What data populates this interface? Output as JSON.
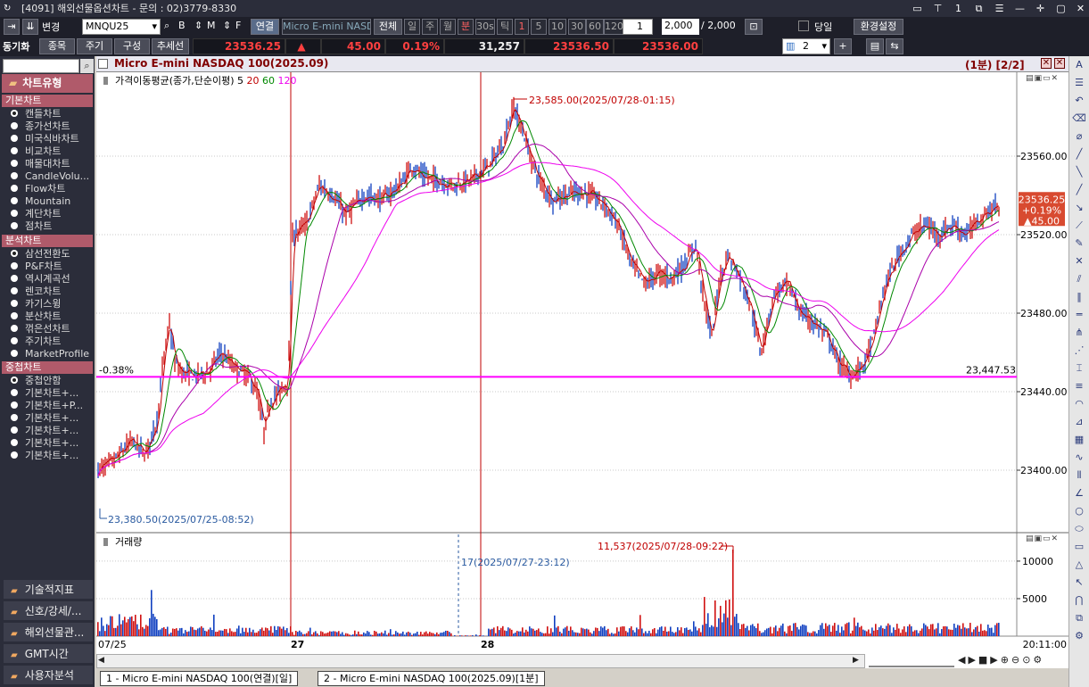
{
  "window": {
    "title": "[4091] 해외선물옵션차트 - 문의 : 02)3779-8330"
  },
  "toolbar": {
    "change_label": "변경",
    "symbol": "MNQU25",
    "b": "B",
    "m": "M",
    "f": "F",
    "link": "연결",
    "all": "전체",
    "periods": [
      "일",
      "주",
      "월",
      "분",
      "30s",
      "틱"
    ],
    "active_period": "분",
    "intervals": [
      "1",
      "5",
      "10",
      "30",
      "60",
      "120"
    ],
    "active_interval": "1",
    "count_value": "1",
    "data_count": "2,000",
    "data_total": "/ 2,000",
    "today": "당일",
    "settings": "환경설정",
    "sync": "동기화",
    "item": "종목",
    "cycle": "주기",
    "compose": "구성",
    "trendline": "추세선",
    "page_num": "2"
  },
  "quote": {
    "price": "23536.25",
    "arrow": "▲",
    "change": "45.00",
    "pct": "0.19%",
    "volume": "31,257",
    "ask": "23536.50",
    "bid": "23536.00"
  },
  "left": {
    "chart_type_head": "차트유형",
    "sections": [
      {
        "head": "기본차트",
        "items": [
          "캔들차트",
          "종가선차트",
          "미국식바차트",
          "비교차트",
          "매물대차트",
          "CandleVolu...",
          "Flow차트",
          "Mountain",
          "계단차트",
          "점차트"
        ]
      },
      {
        "head": "분석차트",
        "items": [
          "삼선전환도",
          "P&F차트",
          "역시계곡선",
          "렌코차트",
          "카기스윙",
          "분산차트",
          "꺾은선차트",
          "주기차트",
          "MarketProfile"
        ]
      },
      {
        "head": "중첩차트",
        "items": [
          "중첩안함",
          "기본차트+...",
          "기본차트+P...",
          "기본차트+...",
          "기본차트+...",
          "기본차트+...",
          "기본차트+..."
        ]
      }
    ],
    "buttons": [
      "기술적지표",
      "신호/강세/...",
      "해외선물관...",
      "GMT시간",
      "사용자분석"
    ]
  },
  "chart": {
    "title": "Micro E-mini NASDAQ 100(2025.09)",
    "period": "(1분) [2/2]",
    "ma_label": "가격이동평균(종가,단순이평)",
    "ma_periods": [
      "5",
      "20",
      "60",
      "120"
    ],
    "ma_colors": [
      "#c00000",
      "#009000",
      "#a000a0",
      "#e000e0"
    ],
    "high_note": "23,585.00(2025/07/28-01:15)",
    "low_note": "23,380.50(2025/07/25-08:52)",
    "hline_left": "-0.38%",
    "hline_right": "23,447.53",
    "price_ticks": [
      "23560.00",
      "23520.00",
      "23480.00",
      "23440.00",
      "23400.00"
    ],
    "current_price": "23536.25",
    "current_pct": "+0.19%",
    "current_chg": "▲45.00",
    "vol_title": "거래량",
    "vol_max_note": "11,537(2025/07/28-09:22)",
    "vol_min_note": "17(2025/07/27-23:12)",
    "vol_ticks": [
      "10000",
      "5000"
    ],
    "x_labels": [
      "07/25",
      "27",
      "28"
    ],
    "time": "20:11:00"
  },
  "chart_data": {
    "type": "line",
    "series": [
      {
        "name": "Micro E-mini NASDAQ 100(2025.09)",
        "x": [
          "2025/07/25-08:52",
          "2025/07/28-01:15"
        ],
        "y": [
          23380.5,
          23585.0
        ]
      },
      {
        "name": "거래량",
        "x": [
          "2025/07/27-23:12",
          "2025/07/28-09:22"
        ],
        "y": [
          17,
          11537
        ]
      }
    ],
    "ylim": [
      23380,
      23590
    ],
    "hline": 23447.53
  },
  "tabs": [
    "1 - Micro E-mini NASDAQ 100(연결)[일]",
    "2 - Micro E-mini NASDAQ 100(2025.09)[1분]"
  ],
  "colors": {
    "ma5": "#c00000",
    "ma20": "#008800",
    "ma60": "#aa00aa",
    "ma120": "#ee00ee",
    "hline": "#ff00ff",
    "up": "#d01010",
    "down": "#1040c0"
  }
}
